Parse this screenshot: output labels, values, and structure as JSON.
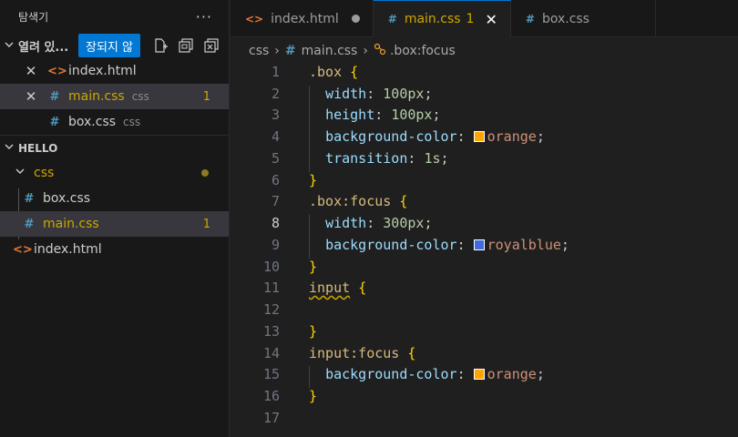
{
  "sidebar": {
    "title": "탐색기",
    "more": "···",
    "open_editors": {
      "title": "열려 있...",
      "tooltip": "장되지 않",
      "items": [
        {
          "name": "index.html",
          "sub": "",
          "badge": ""
        },
        {
          "name": "main.css",
          "sub": "css",
          "badge": "1"
        },
        {
          "name": "box.css",
          "sub": "css",
          "badge": ""
        }
      ]
    },
    "workspace": {
      "title": "HELLO",
      "folder": "css",
      "files": [
        {
          "name": "box.css",
          "badge": ""
        },
        {
          "name": "main.css",
          "badge": "1"
        },
        {
          "name": "index.html",
          "badge": ""
        }
      ]
    }
  },
  "tabs": [
    {
      "label": "index.html",
      "num": "",
      "state": "dirty"
    },
    {
      "label": "main.css",
      "num": "1",
      "state": "active"
    },
    {
      "label": "box.css",
      "num": "",
      "state": "normal"
    }
  ],
  "breadcrumb": {
    "folder": "css",
    "file": "main.css",
    "symbol": ".box:focus"
  },
  "editor": {
    "current_line": 8,
    "line_numbers": [
      "1",
      "2",
      "3",
      "4",
      "5",
      "6",
      "7",
      "8",
      "9",
      "10",
      "11",
      "12",
      "13",
      "14",
      "15",
      "16",
      "17"
    ],
    "lines": {
      "l1_sel": ".box",
      "l1_brace": "{",
      "l2_prop": "width",
      "l2_val": "100px",
      "l3_prop": "height",
      "l3_val": "100px",
      "l4_prop": "background-color",
      "l4_val": "orange",
      "l5_prop": "transition",
      "l5_val": "1s",
      "l6_brace": "}",
      "l7_sel": ".box:focus",
      "l7_brace": "{",
      "l8_prop": "width",
      "l8_val": "300px",
      "l9_prop": "background-color",
      "l9_val": "royalblue",
      "l10_brace": "}",
      "l11_sel": "input",
      "l11_brace": "{",
      "l13_brace": "}",
      "l14_sel": "input:focus",
      "l14_brace": "{",
      "l15_prop": "background-color",
      "l15_val": "orange",
      "l16_brace": "}"
    },
    "colors": {
      "orange": "#ffa500",
      "royalblue": "#4169e1"
    }
  }
}
